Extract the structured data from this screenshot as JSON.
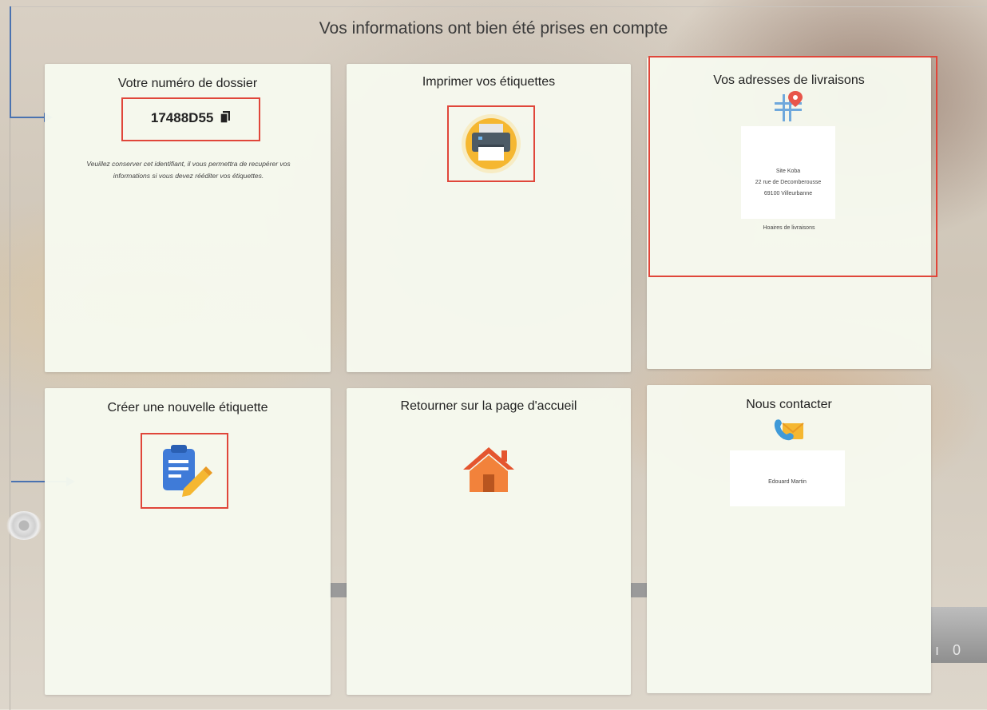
{
  "header": {
    "title": "Vos informations ont bien été prises en compte"
  },
  "cards": {
    "dossier": {
      "title": "Votre numéro de dossier",
      "number": "17488D55",
      "note_line1": "Veuillez conserver cet identifiant, il vous permettra de recupérer vos",
      "note_line2": "informations si vous devez rééditer vos étiquettes."
    },
    "print": {
      "title": "Imprimer vos étiquettes",
      "icon": "printer-icon"
    },
    "addresses": {
      "title": "Vos adresses de livraisons",
      "icon": "map-pin-icon",
      "address_lines": [
        "Site Koba",
        "22 rue de Decomberousse",
        "69100 Villeurbanne"
      ],
      "hours_label": "Hoaires de livraisons"
    },
    "new_label": {
      "title": "Créer une nouvelle étiquette",
      "icon": "clipboard-edit-icon"
    },
    "home": {
      "title": "Retourner sur la page d'accueil",
      "icon": "home-icon"
    },
    "contact": {
      "title": "Nous contacter",
      "icon": "phone-mail-icon",
      "contact_name": "Edouard Martin"
    }
  },
  "colors": {
    "highlight": "#e0463a",
    "arrow": "#4a72b0",
    "card_bg": "#f6f9ee",
    "printer_circle": "#f5b731",
    "home_orange": "#f2823b",
    "clipboard_blue": "#3f7bd8"
  }
}
